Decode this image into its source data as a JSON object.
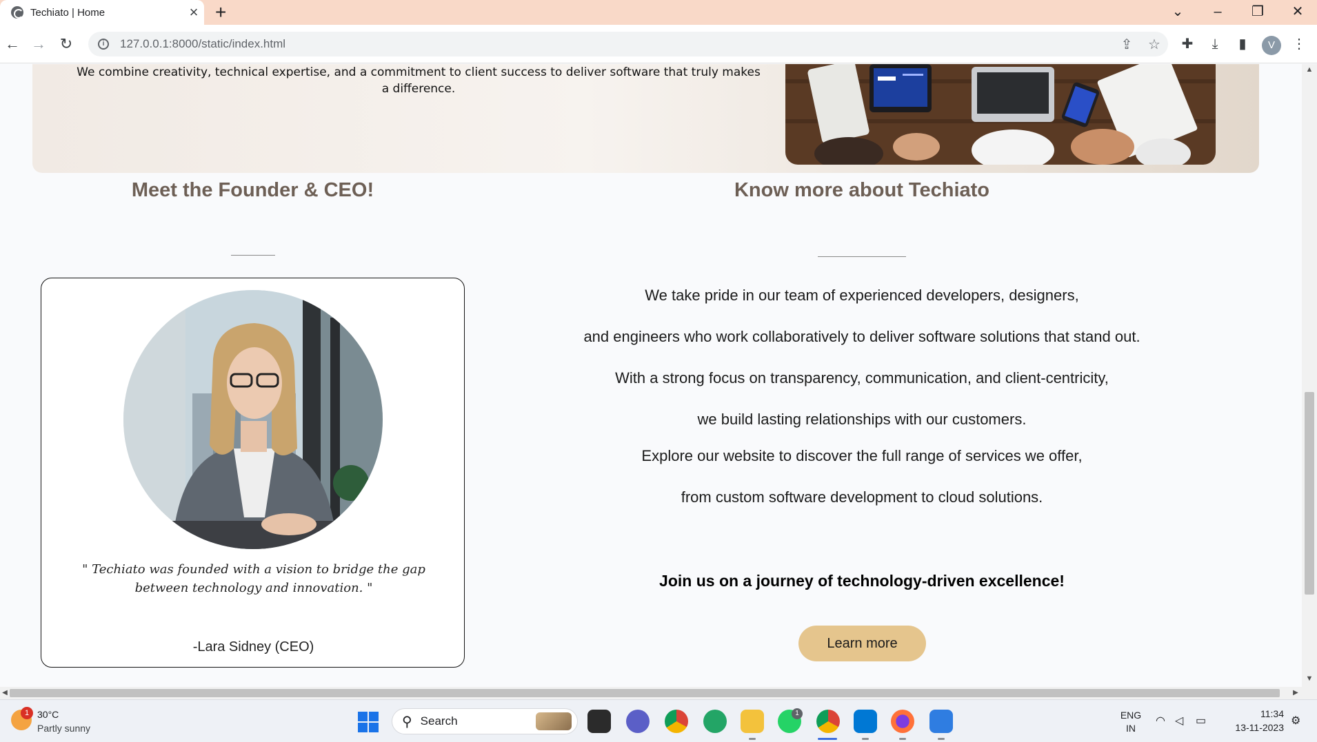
{
  "browser": {
    "tab_title": "Techiato | Home",
    "url": "127.0.0.1:8000/static/index.html",
    "profile_initial": "V",
    "icons": [
      "globe-favicon",
      "close-icon",
      "new-tab-plus",
      "back-arrow",
      "forward-arrow",
      "reload-icon",
      "site-info-icon",
      "share-icon",
      "bookmark-star-icon",
      "extensions-puzzle-icon",
      "download-icon",
      "side-panel-icon",
      "kebab-menu-icon"
    ]
  },
  "hero": {
    "text": "We combine creativity, technical expertise, and a commitment to client success to deliver software that truly makes a difference."
  },
  "founder": {
    "heading": "Meet the Founder & CEO!",
    "quote": "\" Techiato was founded with a vision to bridge the gap between technology and innovation. \"",
    "signature": "-Lara Sidney (CEO)"
  },
  "about": {
    "heading": "Know more about Techiato",
    "lines": [
      "We take pride in our team of experienced developers, designers,",
      "and engineers who work collaboratively to deliver software solutions that stand out.",
      "With a strong focus on transparency, communication, and client-centricity,",
      "we build lasting relationships with our customers.",
      "Explore our website to discover the full range of services we offer,",
      "from custom software development to cloud solutions."
    ],
    "cta_text": "Join us on a journey of technology-driven excellence!",
    "button_label": "Learn more"
  },
  "taskbar": {
    "weather_temp": "30°C",
    "weather_desc": "Partly sunny",
    "weather_badge": "1",
    "search_label": "Search",
    "whatsapp_badge": "1",
    "lang_top": "ENG",
    "lang_bottom": "IN",
    "time": "11:34",
    "date": "13-11-2023"
  },
  "colors": {
    "heading": "#6d5f55",
    "button": "#e5c58d",
    "tab_strip": "#f9d9c8"
  }
}
